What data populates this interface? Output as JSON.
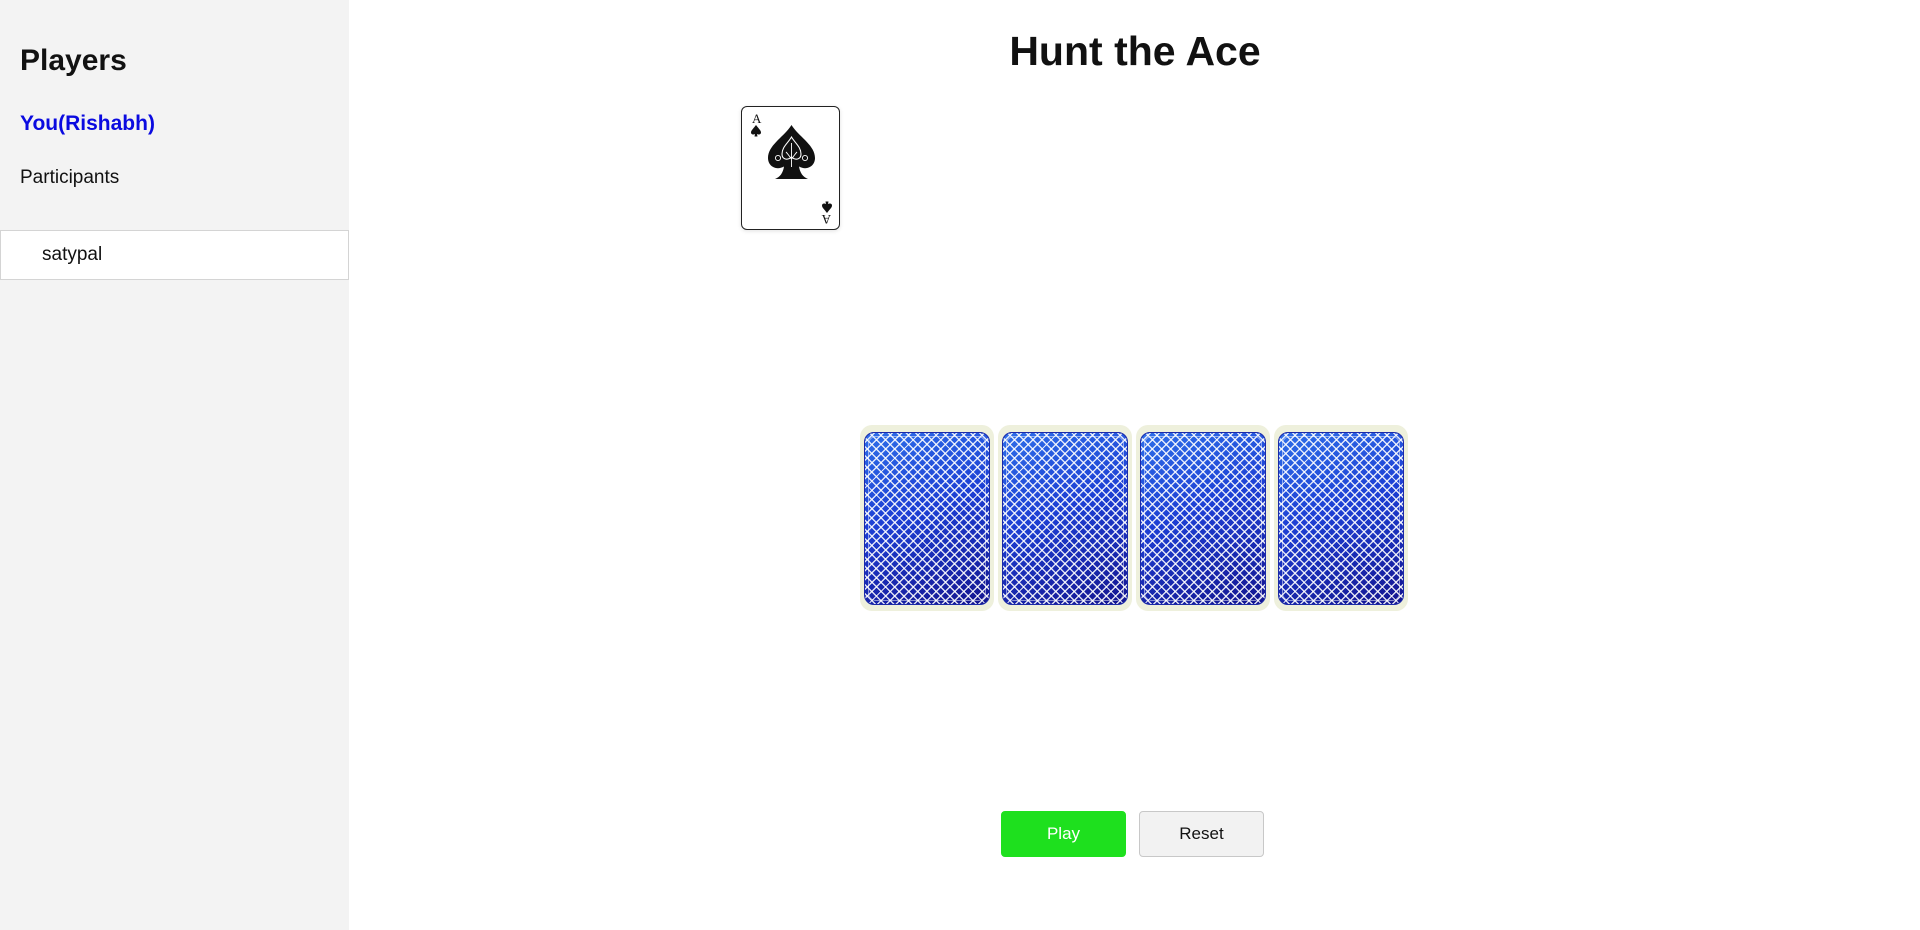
{
  "sidebar": {
    "title": "Players",
    "current_player": "You(Rishabh)",
    "participants_label": "Participants",
    "participants": [
      {
        "name": "satypal"
      }
    ]
  },
  "game": {
    "title": "Hunt the Ace",
    "target_card": {
      "rank": "A",
      "suit": "spades"
    },
    "cards": [
      {
        "face": "down"
      },
      {
        "face": "down"
      },
      {
        "face": "down"
      },
      {
        "face": "down"
      }
    ]
  },
  "controls": {
    "play_label": "Play",
    "reset_label": "Reset"
  },
  "colors": {
    "current_player": "#0a0ae0",
    "play_button": "#1ee01e",
    "card_back": "#1d3fd4",
    "sidebar_bg": "#f3f3f3"
  }
}
